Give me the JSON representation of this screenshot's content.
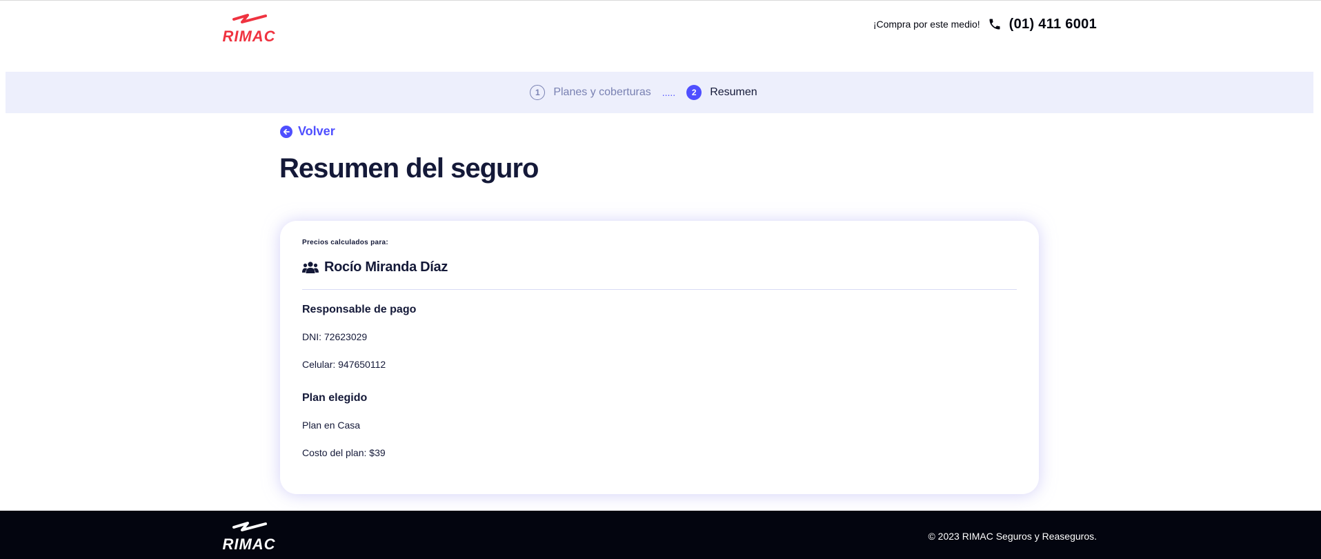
{
  "header": {
    "logo_text": "RIMAC",
    "contact_label": "¡Compra por este medio!",
    "phone_icon": "phone-icon",
    "phone_number": "(01) 411 6001"
  },
  "stepper": {
    "steps": [
      {
        "number": "1",
        "label": "Planes y coberturas",
        "active": false
      },
      {
        "number": "2",
        "label": "Resumen",
        "active": true
      }
    ],
    "separator": "....."
  },
  "back": {
    "label": "Volver",
    "icon": "arrow-left-circle-icon"
  },
  "page_title": "Resumen del seguro",
  "summary": {
    "calc_label": "Precios calculados para:",
    "person_icon": "users-icon",
    "person_name": "Rocío Miranda Díaz",
    "payer_title": "Responsable de pago",
    "dni": "DNI: 72623029",
    "phone": "Celular: 947650112",
    "plan_title": "Plan elegido",
    "plan_name": "Plan en Casa",
    "plan_cost": "Costo del plan: $39"
  },
  "footer": {
    "logo_text": "RIMAC",
    "copyright": "© 2023 RIMAC Seguros y Reaseguros."
  },
  "colors": {
    "brand_red": "#ef3340",
    "accent": "#4f4fff",
    "text_dark": "#141938",
    "stepper_bg": "#edeffc",
    "footer_bg": "#03050f"
  }
}
